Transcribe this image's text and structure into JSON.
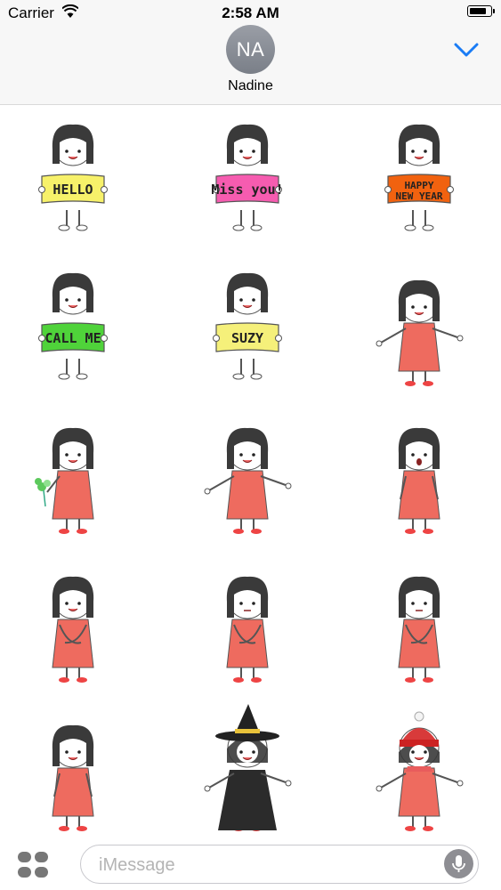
{
  "status_bar": {
    "carrier": "Carrier",
    "time": "2:58 AM",
    "icons": [
      "wifi-icon",
      "battery-icon"
    ]
  },
  "header": {
    "avatar_initials": "NA",
    "contact_name": "Nadine",
    "collapse_icon": "chevron-down-icon",
    "accent_color": "#1a7cf5"
  },
  "stickers": [
    {
      "label": "HELLO",
      "sign_color": "#f7f16a"
    },
    {
      "label": "Miss you!",
      "sign_color": "#f65cb0"
    },
    {
      "label": "HAPPY NEW YEAR",
      "sign_color": "#f1620f"
    },
    {
      "label": "CALL ME",
      "sign_color": "#4fd33a"
    },
    {
      "label": "SUZY",
      "sign_color": "#f5f07a"
    },
    {
      "label": "",
      "sign_color": ""
    },
    {
      "label": "",
      "sign_color": ""
    },
    {
      "label": "",
      "sign_color": ""
    },
    {
      "label": "",
      "sign_color": ""
    },
    {
      "label": "",
      "sign_color": ""
    },
    {
      "label": "",
      "sign_color": ""
    },
    {
      "label": "",
      "sign_color": ""
    },
    {
      "label": "",
      "sign_color": ""
    },
    {
      "label": "",
      "sign_color": ""
    },
    {
      "label": "",
      "sign_color": ""
    }
  ],
  "input_bar": {
    "placeholder": "iMessage",
    "apps_icon": "app-drawer-icon",
    "mic_icon": "microphone-icon"
  }
}
